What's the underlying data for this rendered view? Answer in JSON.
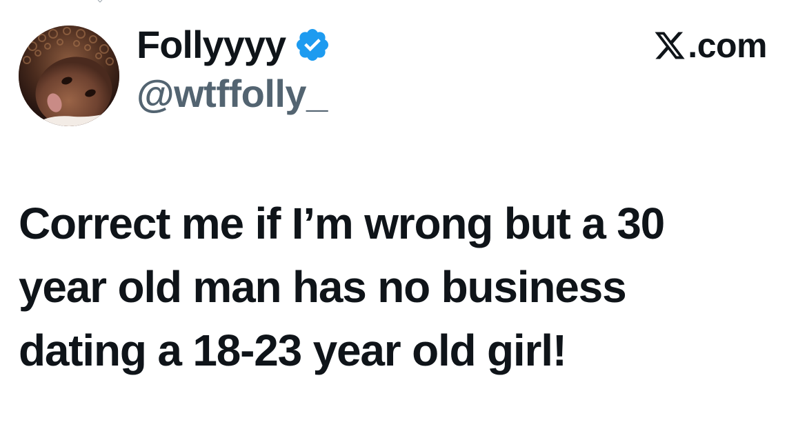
{
  "author": {
    "display_name": "Follyyyy",
    "handle": "@wtffolly_",
    "verified": true,
    "avatar_icon": "profile-photo-avatar"
  },
  "source": {
    "logo_icon": "x-logo-icon",
    "domain_suffix": ".com"
  },
  "tweet": {
    "lines": [
      "Correct me if I’m wrong but a 30",
      "year old man has no business",
      "dating a 18-23 year old girl!"
    ]
  },
  "colors": {
    "text_primary": "#0f1419",
    "text_secondary": "#536471",
    "verified_blue": "#1d9bf0",
    "background": "#ffffff"
  }
}
